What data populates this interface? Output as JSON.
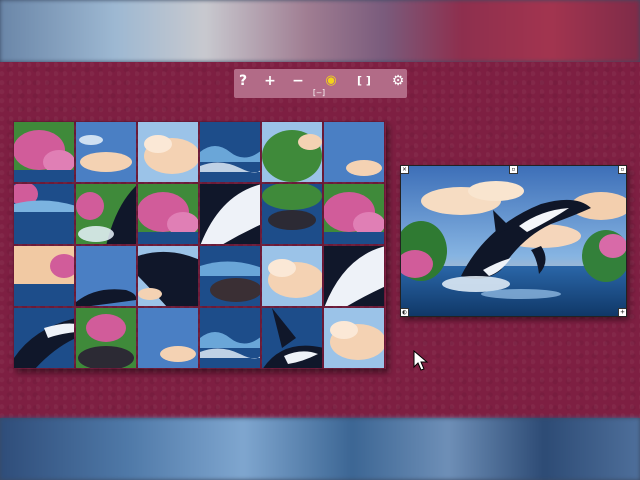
{
  "toolbar": {
    "buttons": [
      {
        "name": "help-button",
        "icon": "question-icon",
        "glyph": "?"
      },
      {
        "name": "zoom-in-button",
        "icon": "plus-icon",
        "glyph": "+"
      },
      {
        "name": "zoom-out-button",
        "icon": "minus-icon",
        "glyph": "−"
      },
      {
        "name": "preview-toggle-button",
        "icon": "eye-icon",
        "glyph": "◉"
      },
      {
        "name": "fit-screen-button",
        "icon": "brackets-icon",
        "glyph": "[ ]"
      },
      {
        "name": "settings-button",
        "icon": "gear-icon",
        "glyph": "⚙"
      }
    ],
    "sub_glyph": "[—]"
  },
  "puzzle": {
    "rows": 4,
    "cols": 6,
    "tile_scenes": [
      [
        "flowers",
        "sky-clouds",
        "clouds",
        "waves",
        "trees",
        "sky"
      ],
      [
        "sea-flowers",
        "splash-orca",
        "flowers",
        "orca-belly",
        "trees-rocks",
        "flowers"
      ],
      [
        "sunset-sea",
        "sky-orca",
        "orca-body",
        "rocks-sea",
        "clouds",
        "orca-belly"
      ],
      [
        "orca-tail",
        "flowers-rocks",
        "sky",
        "waves",
        "orca-fin",
        "clouds"
      ]
    ]
  },
  "preview": {
    "label": "reference-image",
    "handles": {
      "top_left": "✕",
      "top_center": "▫",
      "top_right": "▫",
      "bottom_left": "◐",
      "bottom_right": "+"
    }
  },
  "colors": {
    "board": "#7e1f42",
    "toolbar": "#b26b87",
    "eye_accent": "#f3d21a",
    "sea": "#1d4d8a",
    "sky": "#5e9ad6",
    "cloud": "#f4d2b3",
    "foliage": "#3f8a3a",
    "blossom": "#d15c9a",
    "orca": "#10172a"
  }
}
